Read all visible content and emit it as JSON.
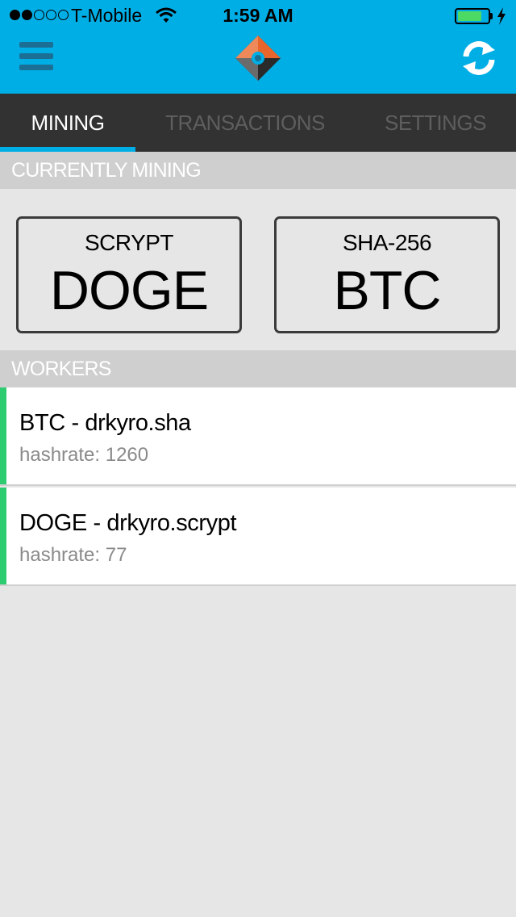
{
  "status_bar": {
    "carrier": "T-Mobile",
    "time": "1:59 AM",
    "signal_bars": 2,
    "signal_total": 5,
    "battery_level": 0.8,
    "battery_color": "#4cd964"
  },
  "header": {
    "background": "#00aee6",
    "menu_icon": "hamburger-menu-icon",
    "logo_icon": "diamond-logo-icon",
    "refresh_icon": "refresh-icon"
  },
  "tabs": [
    {
      "label": "MINING",
      "active": true
    },
    {
      "label": "TRANSACTIONS",
      "active": false
    },
    {
      "label": "SETTINGS",
      "active": false
    }
  ],
  "currently_mining": {
    "header": "CURRENTLY MINING",
    "cards": [
      {
        "algorithm": "SCRYPT",
        "coin": "DOGE"
      },
      {
        "algorithm": "SHA-256",
        "coin": "BTC"
      }
    ]
  },
  "workers": {
    "header": "WORKERS",
    "items": [
      {
        "name": "BTC - drkyro.sha",
        "hashrate": "hashrate: 1260",
        "status_color": "#2ecc71"
      },
      {
        "name": "DOGE - drkyro.scrypt",
        "hashrate": "hashrate: 77",
        "status_color": "#2ecc71"
      }
    ]
  }
}
